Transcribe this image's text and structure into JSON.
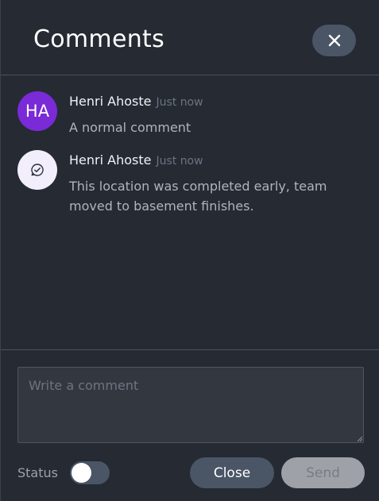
{
  "header": {
    "title": "Comments",
    "close_icon": "close-icon"
  },
  "comments": [
    {
      "avatar_initials": "HA",
      "avatar_color": "#7a2ad6",
      "author": "Henri Ahoste",
      "time": "Just now",
      "text": "A normal comment"
    },
    {
      "avatar_icon": "status-check-icon",
      "author": "Henri Ahoste",
      "time": "Just now",
      "text": "This location was completed early, team moved to basement finishes."
    }
  ],
  "composer": {
    "value": "",
    "placeholder": "Write a comment"
  },
  "footer": {
    "status_label": "Status",
    "status_on": false,
    "close_label": "Close",
    "send_label": "Send",
    "send_enabled": false
  },
  "colors": {
    "panel_bg": "#252a33",
    "button_bg": "#4a5566",
    "avatar_purple": "#7a2ad6",
    "send_disabled_bg": "#9ea2a8"
  }
}
